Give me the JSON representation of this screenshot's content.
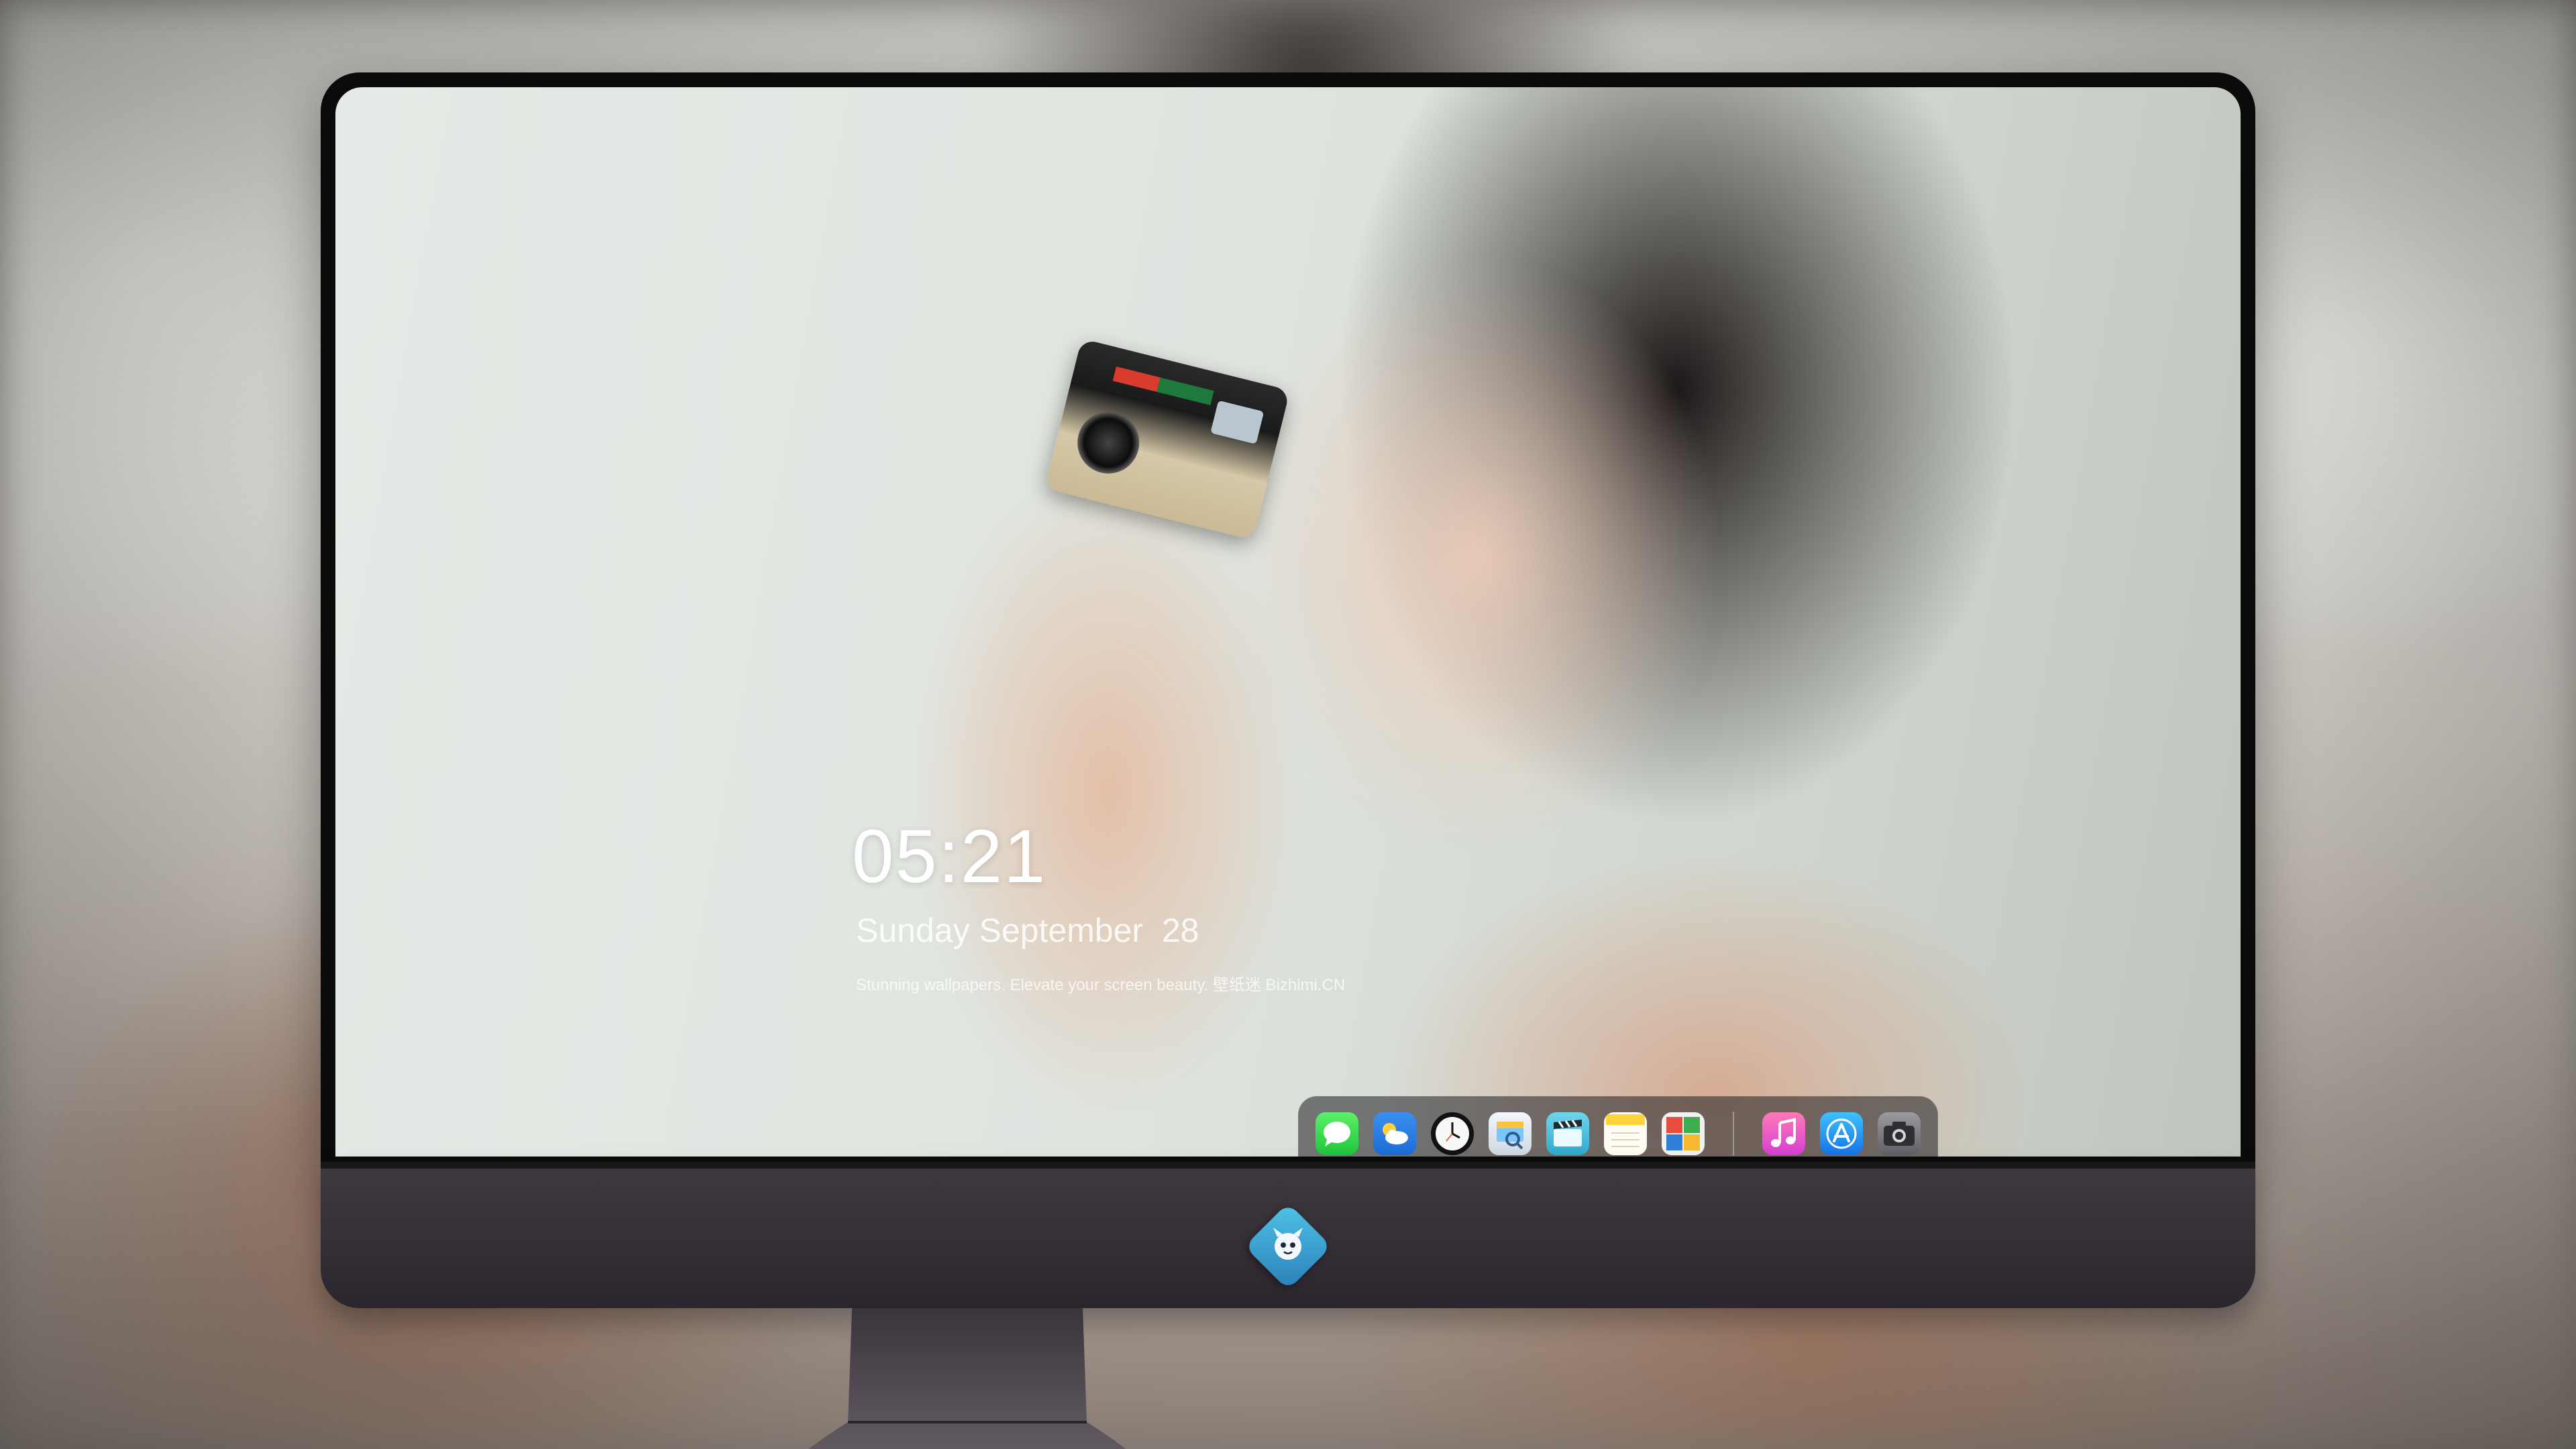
{
  "desktop": {
    "clock_time": "05:21",
    "clock_date": "Sunday September  28",
    "caption": "Stunning wallpapers. Elevate your screen beauty.  壁纸迷   Bizhimi.CN"
  },
  "dock": {
    "apps": [
      {
        "name": "Messages",
        "icon": "messages-icon"
      },
      {
        "name": "Weather",
        "icon": "weather-icon"
      },
      {
        "name": "Clock",
        "icon": "clock-icon"
      },
      {
        "name": "Preview",
        "icon": "preview-icon"
      },
      {
        "name": "Clips",
        "icon": "clapperboard-icon"
      },
      {
        "name": "Notes",
        "icon": "notes-icon"
      },
      {
        "name": "Photo Booth",
        "icon": "photo-booth-icon"
      },
      {
        "name": "Music",
        "icon": "music-icon"
      },
      {
        "name": "App Store",
        "icon": "app-store-icon"
      },
      {
        "name": "Camera",
        "icon": "camera-icon"
      }
    ]
  },
  "colors": {
    "chin": "#3e3840",
    "bezel": "#0b0b0c",
    "dock_background": "rgba(30,30,32,0.55)"
  }
}
